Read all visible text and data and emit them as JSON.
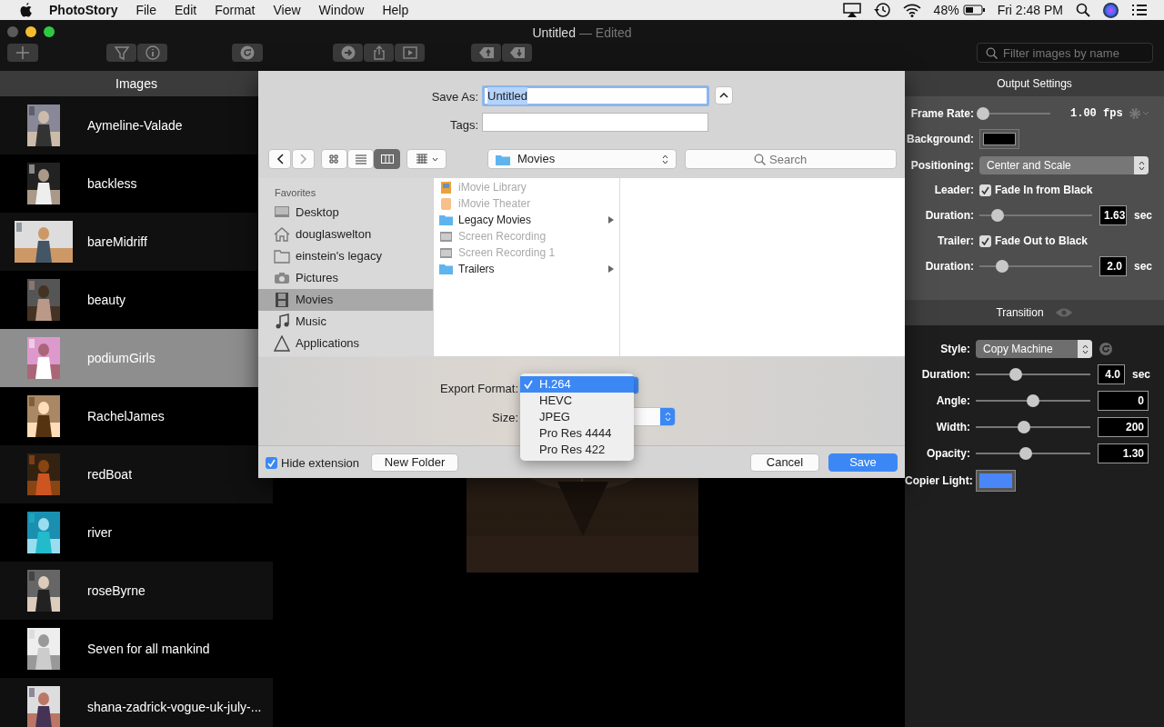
{
  "menu_bar": {
    "app": "PhotoStory",
    "menus": [
      "File",
      "Edit",
      "Format",
      "View",
      "Window",
      "Help"
    ],
    "battery": "48%",
    "clock": "Fri 2:48 PM"
  },
  "window": {
    "title": "Untitled",
    "subtitle": "— Edited",
    "filter_placeholder": "Filter images by name"
  },
  "sidebar": {
    "title": "Images",
    "items": [
      {
        "name": "Aymeline-Valade",
        "selected": false
      },
      {
        "name": "backless",
        "selected": false
      },
      {
        "name": "bareMidriff",
        "selected": false
      },
      {
        "name": "beauty",
        "selected": false
      },
      {
        "name": "podiumGirls",
        "selected": true
      },
      {
        "name": "RachelJames",
        "selected": false
      },
      {
        "name": "redBoat",
        "selected": false
      },
      {
        "name": "river",
        "selected": false
      },
      {
        "name": "roseByrne",
        "selected": false
      },
      {
        "name": "Seven for all mankind",
        "selected": false
      },
      {
        "name": "shana-zadrick-vogue-uk-july-...",
        "selected": false
      }
    ]
  },
  "save_dialog": {
    "save_as_label": "Save As:",
    "save_as_value": "Untitled",
    "tags_label": "Tags:",
    "location": "Movies",
    "search_placeholder": "Search",
    "favorites_title": "Favorites",
    "favorites": [
      {
        "label": "Desktop",
        "kind": "desktop",
        "selected": false
      },
      {
        "label": "douglaswelton",
        "kind": "home",
        "selected": false
      },
      {
        "label": "einstein's legacy",
        "kind": "folder",
        "selected": false
      },
      {
        "label": "Pictures",
        "kind": "camera",
        "selected": false
      },
      {
        "label": "Movies",
        "kind": "film",
        "selected": true
      },
      {
        "label": "Music",
        "kind": "music",
        "selected": false
      },
      {
        "label": "Applications",
        "kind": "apps",
        "selected": false
      }
    ],
    "files": [
      {
        "name": "iMovie Library",
        "kind": "library",
        "disabled": true,
        "has_children": false
      },
      {
        "name": "iMovie Theater",
        "kind": "theater",
        "disabled": true,
        "has_children": false
      },
      {
        "name": "Legacy Movies",
        "kind": "folder",
        "disabled": false,
        "has_children": true
      },
      {
        "name": "Screen Recording",
        "kind": "recording",
        "disabled": true,
        "has_children": false
      },
      {
        "name": "Screen Recording 1",
        "kind": "recording",
        "disabled": true,
        "has_children": false
      },
      {
        "name": "Trailers",
        "kind": "folder",
        "disabled": false,
        "has_children": true
      }
    ],
    "export_format_label": "Export Format:",
    "size_label": "Size:",
    "format_options": [
      {
        "label": "H.264",
        "selected": true
      },
      {
        "label": "HEVC",
        "selected": false
      },
      {
        "label": "JPEG",
        "selected": false
      },
      {
        "label": "Pro Res 4444",
        "selected": false
      },
      {
        "label": "Pro Res 422",
        "selected": false
      }
    ],
    "hide_extension": {
      "label": "Hide extension",
      "checked": true
    },
    "new_folder": "New Folder",
    "cancel": "Cancel",
    "save": "Save"
  },
  "output_settings": {
    "title": "Output Settings",
    "frame_rate_label": "Frame Rate:",
    "frame_rate": {
      "level": 0.05
    },
    "frame_rate_value": "1.00 fps",
    "background_label": "Background:",
    "background": {
      "color": "#000000"
    },
    "positioning_label": "Positioning:",
    "positioning": "Center and Scale",
    "leader_label": "Leader:",
    "leader": {
      "label": "Fade In from Black",
      "checked": true
    },
    "leader_duration_label": "Duration:",
    "leader_duration": {
      "level": 0.16
    },
    "leader_duration_value": "1.63",
    "leader_unit": "sec",
    "trailer_label": "Trailer:",
    "trailer": {
      "label": "Fade Out to Black",
      "checked": true
    },
    "trailer_duration_label": "Duration:",
    "trailer_duration": {
      "level": 0.2
    },
    "trailer_duration_value": "2.0",
    "trailer_unit": "sec"
  },
  "transition": {
    "title": "Transition",
    "style_label": "Style:",
    "style": "Copy Machine",
    "params": [
      {
        "label": "Duration:",
        "level": 0.35,
        "value": "4.0",
        "unit": "sec"
      },
      {
        "label": "Angle:",
        "level": 0.5,
        "value": "0"
      },
      {
        "label": "Width:",
        "level": 0.42,
        "value": "200"
      },
      {
        "label": "Opacity:",
        "level": 0.44,
        "value": "1.30"
      }
    ],
    "copier_light_label": "Copier Light:",
    "copier_light": {
      "color": "#4a86f7"
    }
  }
}
